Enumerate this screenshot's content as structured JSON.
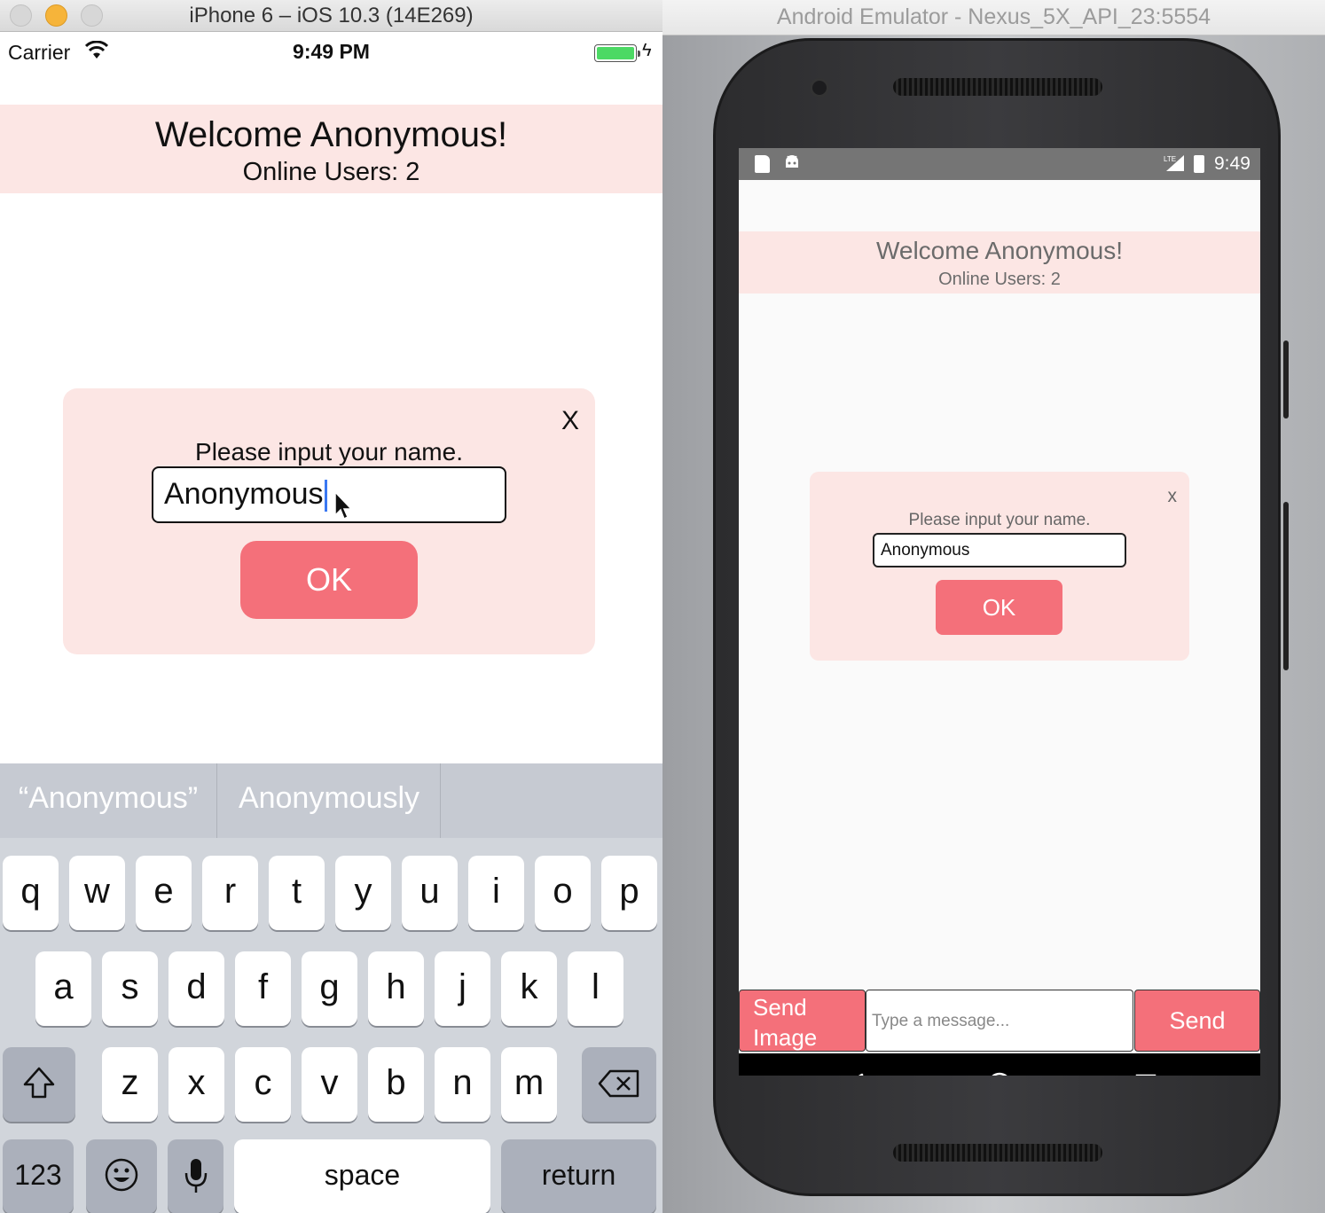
{
  "ios": {
    "window_title": "iPhone 6 – iOS 10.3 (14E269)",
    "status": {
      "carrier": "Carrier",
      "time": "9:49 PM"
    },
    "header": {
      "welcome": "Welcome Anonymous!",
      "online": "Online Users: 2"
    },
    "modal": {
      "close": "X",
      "prompt": "Please input your name.",
      "name_value": "Anonymous",
      "ok_label": "OK"
    },
    "keyboard": {
      "suggestions": [
        "“Anonymous”",
        "Anonymously"
      ],
      "row1": [
        "q",
        "w",
        "e",
        "r",
        "t",
        "y",
        "u",
        "i",
        "o",
        "p"
      ],
      "row2": [
        "a",
        "s",
        "d",
        "f",
        "g",
        "h",
        "j",
        "k",
        "l"
      ],
      "row3": [
        "z",
        "x",
        "c",
        "v",
        "b",
        "n",
        "m"
      ],
      "numbers_key": "123",
      "space_key": "space",
      "return_key": "return"
    }
  },
  "android": {
    "window_title": "Android Emulator - Nexus_5X_API_23:5554",
    "status": {
      "time": "9:49"
    },
    "header": {
      "welcome": "Welcome Anonymous!",
      "online": "Online Users: 2"
    },
    "modal": {
      "close": "x",
      "prompt": "Please input your name.",
      "name_value": "Anonymous",
      "ok_label": "OK"
    },
    "bottom_bar": {
      "send_image": "Send Image",
      "message_placeholder": "Type a message...",
      "send": "Send"
    }
  },
  "colors": {
    "accent": "#f4707a",
    "header_bg": "#fce6e4",
    "keyboard_bg": "#d1d5db"
  }
}
